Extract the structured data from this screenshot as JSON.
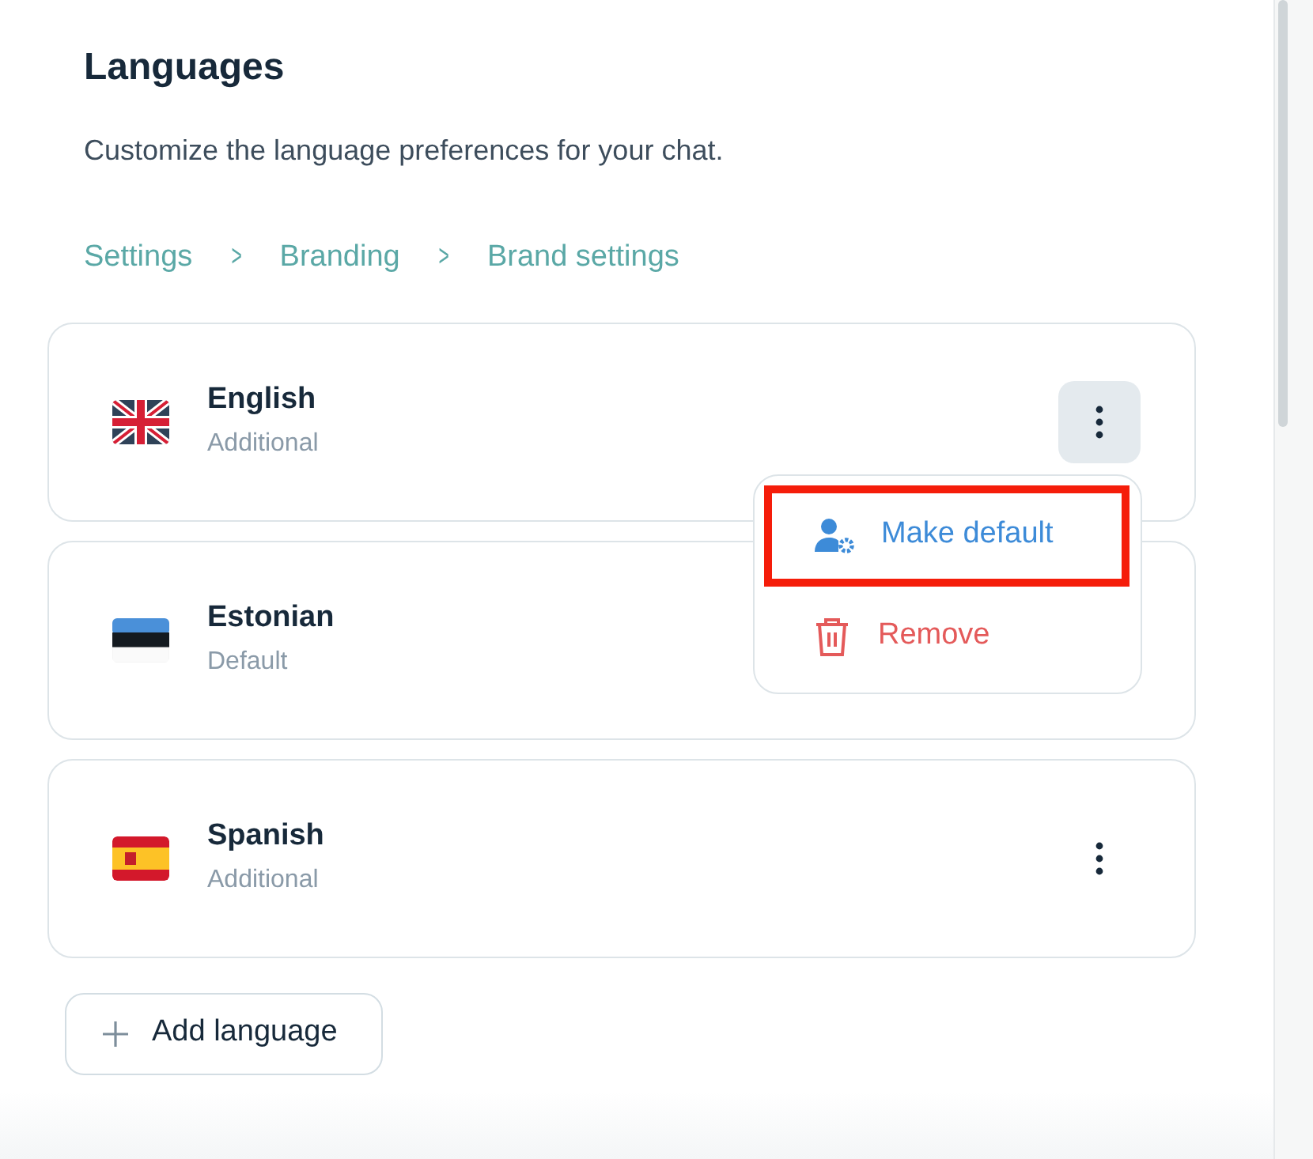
{
  "title": "Languages",
  "description": "Customize the language preferences for your chat.",
  "breadcrumb": [
    "Settings",
    "Branding",
    "Brand settings"
  ],
  "breadcrumb_separator": ">",
  "languages": [
    {
      "name": "English",
      "role": "Additional",
      "kind": "uk",
      "menu_button": {
        "open": true
      }
    },
    {
      "name": "Estonian",
      "role": "Default",
      "kind": "ee"
    },
    {
      "name": "Spanish",
      "role": "Additional",
      "kind": "es",
      "menu_button": {
        "open": false
      }
    }
  ],
  "menu": {
    "items": [
      {
        "label": "Make default",
        "kind": "default",
        "highlighted": true
      },
      {
        "label": "Remove",
        "kind": "remove",
        "highlighted": false
      }
    ]
  },
  "add_button": {
    "label": "Add language"
  }
}
